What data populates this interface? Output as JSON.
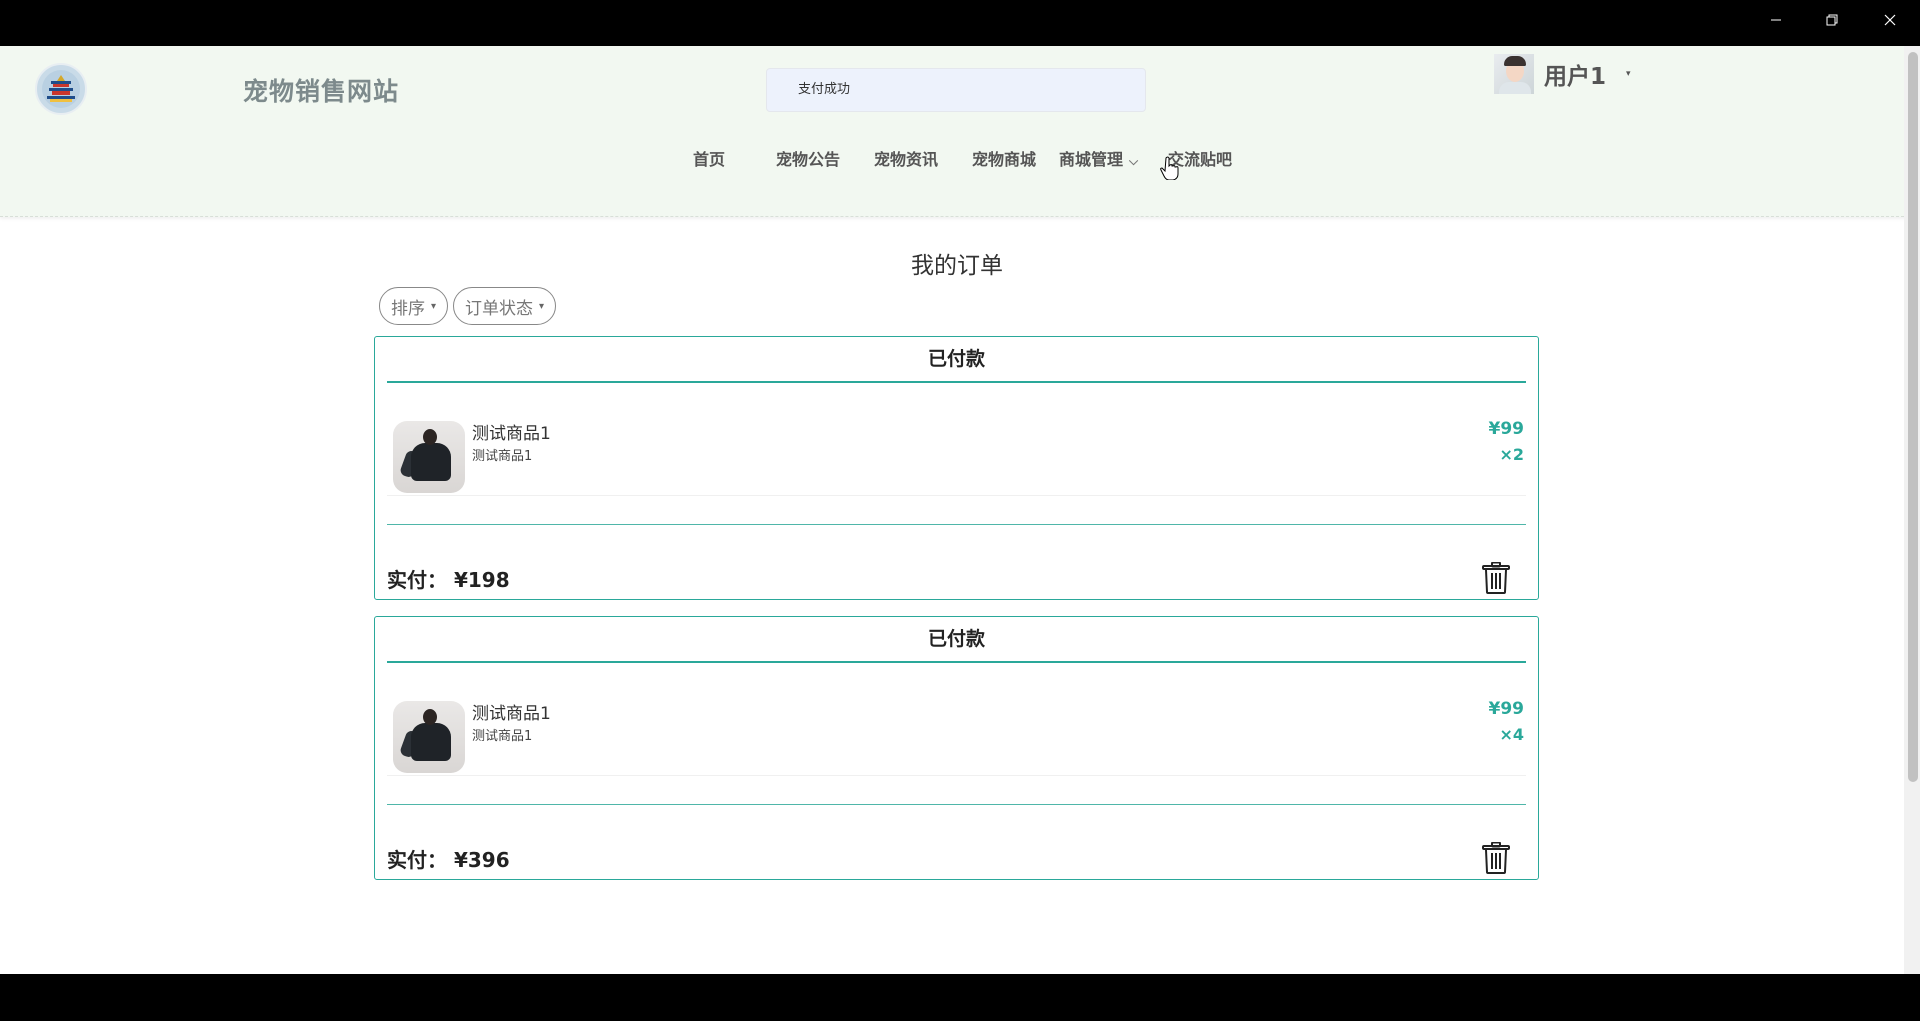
{
  "window": {
    "minimize_icon": "minimize-icon",
    "maximize_icon": "restore-icon",
    "close_icon": "close-icon"
  },
  "header": {
    "logo_icon": "temple-logo-icon",
    "site_title": "宠物销售网站",
    "toast_message": "支付成功",
    "user": {
      "name": "用户1",
      "caret": "▾"
    }
  },
  "nav": {
    "items": [
      {
        "label": "首页"
      },
      {
        "label": "宠物公告"
      },
      {
        "label": "宠物资讯"
      },
      {
        "label": "宠物商城"
      },
      {
        "label": "商城管理",
        "has_dropdown": true,
        "chevron": "⌵"
      },
      {
        "label": "交流贴吧"
      }
    ]
  },
  "main": {
    "title": "我的订单",
    "filters": [
      {
        "label": "排序",
        "caret": "▾"
      },
      {
        "label": "订单状态",
        "caret": "▾"
      }
    ],
    "orders": [
      {
        "status": "已付款",
        "product": {
          "name": "测试商品1",
          "subtitle": "测试商品1",
          "price": "¥99",
          "quantity": "×2"
        },
        "paid": "实付： ¥198"
      },
      {
        "status": "已付款",
        "product": {
          "name": "测试商品1",
          "subtitle": "测试商品1",
          "price": "¥99",
          "quantity": "×4"
        },
        "paid": "实付： ¥396"
      }
    ]
  },
  "colors": {
    "accent": "#2aa89a",
    "header_bg": "#f2f8f1",
    "toast_bg": "#edf2fc",
    "site_title": "#7d8a8c"
  }
}
